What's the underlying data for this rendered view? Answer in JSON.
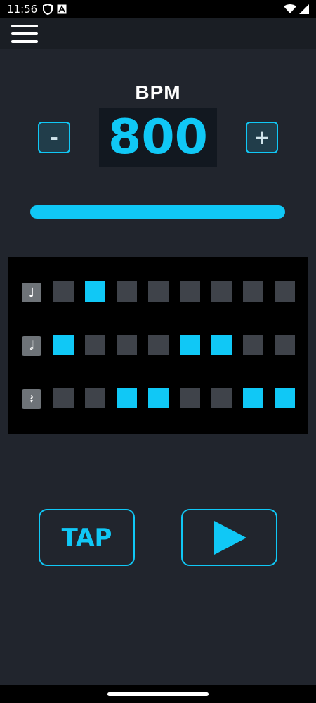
{
  "status": {
    "time": "11:56",
    "icons": [
      "shield-icon",
      "text-a-icon",
      "wifi-icon",
      "signal-icon"
    ]
  },
  "app_bar": {
    "menu_icon": "hamburger-menu-icon"
  },
  "tempo": {
    "label": "BPM",
    "value": "800",
    "minus_label": "-",
    "plus_label": "+",
    "slider_fraction": 1.0
  },
  "pattern": {
    "rows": [
      {
        "icon": "quarter-note-icon",
        "glyph": "♩",
        "cells": [
          false,
          true,
          false,
          false,
          false,
          false,
          false,
          false
        ]
      },
      {
        "icon": "half-note-icon",
        "glyph": "𝅗𝅥",
        "cells": [
          true,
          false,
          false,
          false,
          true,
          true,
          false,
          false
        ]
      },
      {
        "icon": "rest-icon",
        "glyph": "𝄽",
        "cells": [
          false,
          false,
          true,
          true,
          false,
          false,
          true,
          true
        ]
      }
    ]
  },
  "controls": {
    "tap_label": "TAP",
    "play_icon": "play-icon"
  },
  "colors": {
    "accent": "#10c8f6",
    "background": "#21252d",
    "cell_off": "#3f434a",
    "panel": "#000000"
  }
}
